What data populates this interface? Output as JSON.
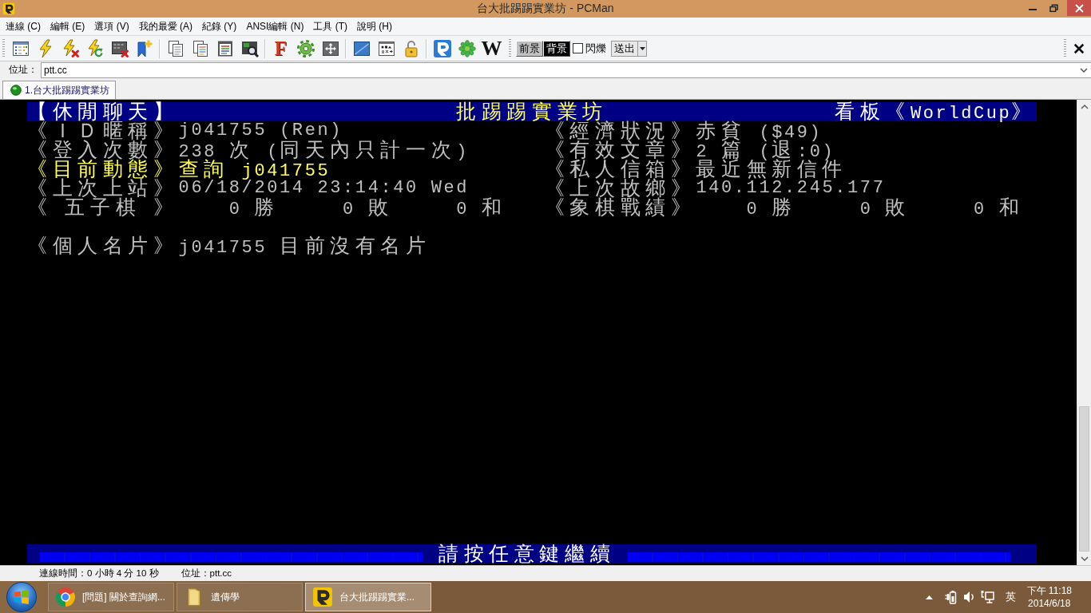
{
  "window": {
    "title": "台大批踢踢實業坊 - PCMan"
  },
  "menu": [
    "連線 (C)",
    "編輯 (E)",
    "選項 (V)",
    "我的最愛 (A)",
    "紀錄 (Y)",
    "ANSI編輯 (N)",
    "工具 (T)",
    "說明 (H)"
  ],
  "toolbar": {
    "letter_icons": [
      "F",
      "W"
    ],
    "color_buttons": [
      {
        "label": "前景",
        "color": "#c0c0c0"
      },
      {
        "label": "背景",
        "color": "#000000"
      }
    ],
    "blink": {
      "label": "閃爍",
      "checked": false
    },
    "send_button": "送出"
  },
  "address_bar": {
    "label": "位址：",
    "value": "ptt.cc"
  },
  "tabs": [
    {
      "label": "1.台大批踢踢實業坊",
      "selected": true
    }
  ],
  "terminal": {
    "header": {
      "category": "【休閒聊天】",
      "title": "批踢踢實業坊",
      "board": "看板《WorldCup》"
    },
    "rows": [
      {
        "kind": "pair",
        "left": {
          "label": "《ＩＤ暱稱》",
          "value": "j041755 (Ren)",
          "highlighted": false
        },
        "right": {
          "label": "《經濟狀況》",
          "value": "赤貧 ($49)",
          "highlighted": false
        }
      },
      {
        "kind": "pair",
        "left": {
          "label": "《登入次數》",
          "value": "238 次 (同天內只計一次)",
          "highlighted": false
        },
        "right": {
          "label": "《有效文章》",
          "value": "2 篇 (退:0)",
          "highlighted": false
        }
      },
      {
        "kind": "pair",
        "left": {
          "label": "《目前動態》",
          "value": "查詢 j041755",
          "highlighted": true
        },
        "right": {
          "label": "《私人信箱》",
          "value": "最近無新信件",
          "highlighted": false
        }
      },
      {
        "kind": "pair",
        "left": {
          "label": "《上次上站》",
          "value": "06/18/2014 23:14:40 Wed",
          "highlighted": false
        },
        "right": {
          "label": "《上次故鄉》",
          "value": "140.112.245.177",
          "highlighted": false
        }
      },
      {
        "kind": "record",
        "left": {
          "label": "《 五子棋 》",
          "results": [
            "0 勝",
            "0 敗",
            "0 和"
          ],
          "highlighted": false
        },
        "right": {
          "label": "《象棋戰績》",
          "results": [
            "0 勝",
            "0 敗",
            "0 和"
          ],
          "highlighted": false
        }
      },
      {
        "kind": "card",
        "left": {
          "label": "《個人名片》",
          "value": "j041755 目前沒有名片",
          "highlighted": false
        }
      }
    ],
    "footer": "請按任意鍵繼續"
  },
  "status_bar": {
    "connection_time": "連線時間：0 小時 4 分 10 秒",
    "address": "位址：ptt.cc"
  },
  "taskbar": {
    "items": [
      {
        "label": "[問題] 關於查詢網...",
        "selected": false
      },
      {
        "label": "遺傳學",
        "selected": false
      },
      {
        "label": "台大批踢踢實業...",
        "selected": true
      }
    ],
    "language": "英",
    "time": "下午 11:18",
    "date": "2014/6/18"
  }
}
